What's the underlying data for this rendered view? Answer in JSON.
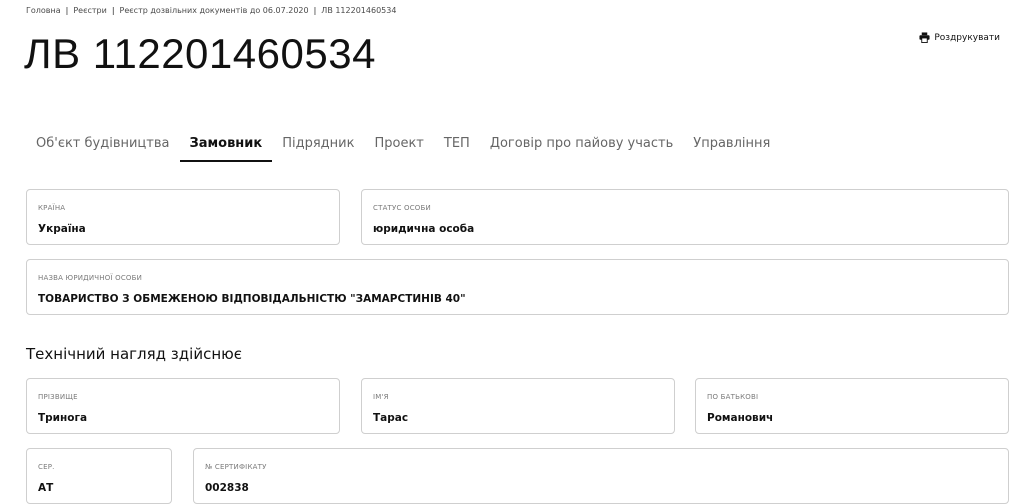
{
  "breadcrumb": {
    "items": [
      "Головна",
      "Реєстри",
      "Реєстр дозвільних документів до 06.07.2020",
      "ЛВ 112201460534"
    ]
  },
  "page": {
    "title": "ЛВ 112201460534",
    "print_label": "Роздрукувати",
    "print_icon": "printer-icon"
  },
  "tabs": [
    {
      "label": "Об'єкт будівництва",
      "active": false
    },
    {
      "label": "Замовник",
      "active": true
    },
    {
      "label": "Підрядник",
      "active": false
    },
    {
      "label": "Проект",
      "active": false
    },
    {
      "label": "ТЕП",
      "active": false
    },
    {
      "label": "Договір про пайову участь",
      "active": false
    },
    {
      "label": "Управління",
      "active": false
    }
  ],
  "customer": {
    "country_label": "Країна",
    "country_value": "Україна",
    "status_label": "Статус особи",
    "status_value": "юридична особа",
    "legal_name_label": "Назва юридичної особи",
    "legal_name_value": "ТОВАРИСТВО З ОБМЕЖЕНОЮ ВІДПОВІДАЛЬНІСТЮ \"ЗАМАРСТИНІВ 40\""
  },
  "supervision": {
    "heading": "Технічний нагляд здійснює",
    "surname_label": "Прізвище",
    "surname_value": "Тринога",
    "name_label": "Ім'я",
    "name_value": "Тарас",
    "patronymic_label": "По батькові",
    "patronymic_value": "Романович",
    "series_label": "Сер.",
    "series_value": "АТ",
    "cert_label": "№ сертифікату",
    "cert_value": "002838"
  },
  "colors": {
    "border": "#cfcfcf",
    "text": "#111111",
    "muted": "#7a7a7a"
  }
}
